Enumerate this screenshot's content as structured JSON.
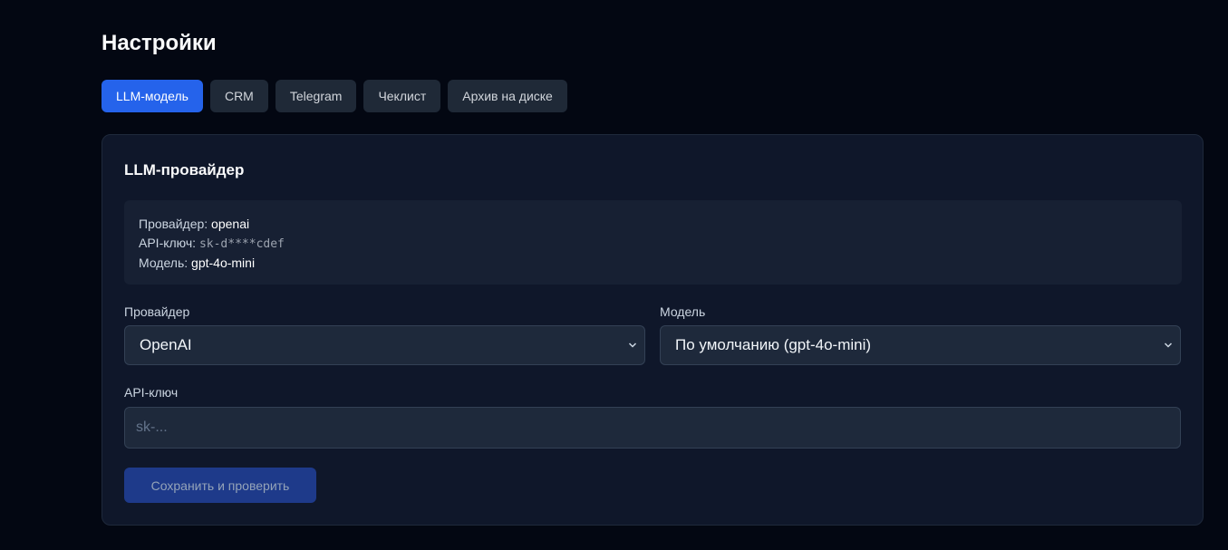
{
  "page": {
    "title": "Настройки"
  },
  "tabs": [
    {
      "label": "LLM-модель",
      "active": true
    },
    {
      "label": "CRM",
      "active": false
    },
    {
      "label": "Telegram",
      "active": false
    },
    {
      "label": "Чеклист",
      "active": false
    },
    {
      "label": "Архив на диске",
      "active": false
    }
  ],
  "card": {
    "title": "LLM-провайдер",
    "info": {
      "provider_label": "Провайдер:",
      "provider_value": "openai",
      "api_key_label": "API-ключ:",
      "api_key_value": "sk-d****cdef",
      "model_label": "Модель:",
      "model_value": "gpt-4o-mini"
    },
    "provider_field": {
      "label": "Провайдер",
      "selected": "OpenAI"
    },
    "model_field": {
      "label": "Модель",
      "selected": "По умолчанию (gpt-4o-mini)"
    },
    "api_key_field": {
      "label": "API-ключ",
      "value": "",
      "placeholder": "sk-..."
    },
    "save_label": "Сохранить и проверить"
  },
  "colors": {
    "accent": "#2563eb",
    "background": "#030712",
    "card": "#0f172a"
  },
  "icons": {
    "select_chevron": "chevron-down-icon"
  }
}
